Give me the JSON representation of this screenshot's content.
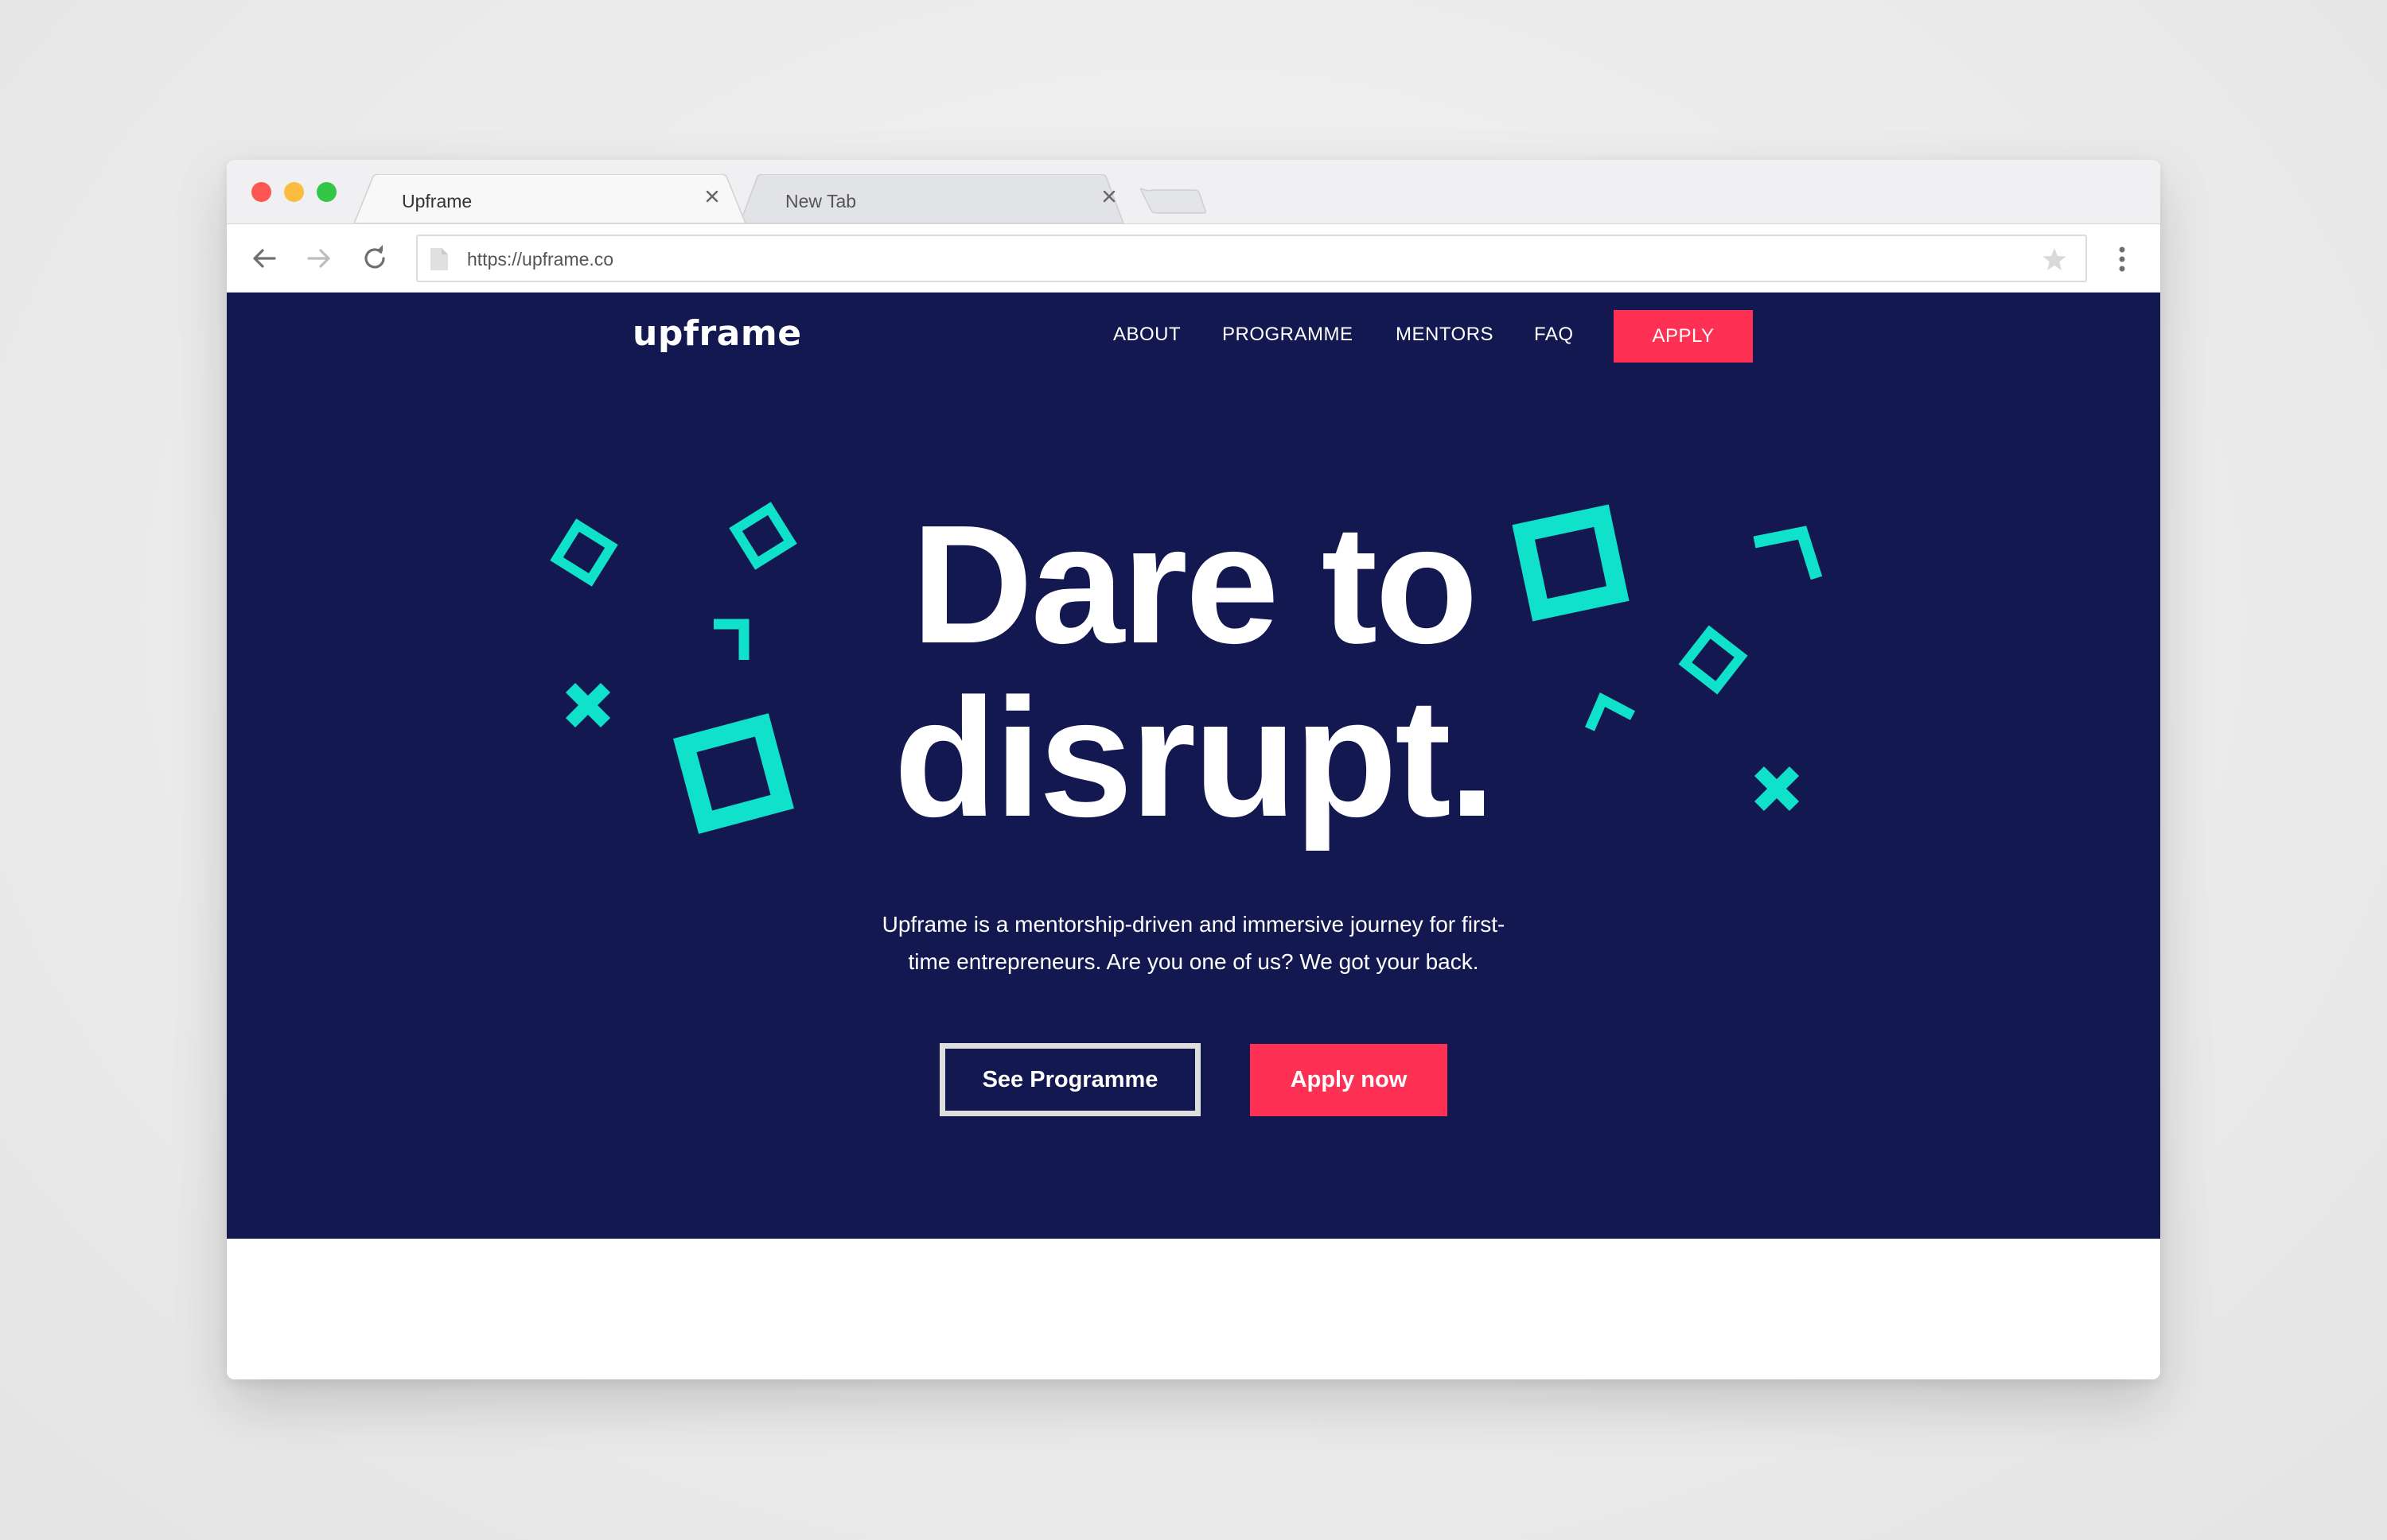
{
  "browser": {
    "tabs": [
      {
        "label": "Upframe",
        "active": true
      },
      {
        "label": "New Tab",
        "active": false
      }
    ],
    "url": "https://upframe.co"
  },
  "site": {
    "logo": "upframe",
    "nav": {
      "about": "ABOUT",
      "programme": "PROGRAMME",
      "mentors": "MENTORS",
      "faq": "FAQ",
      "apply": "APPLY"
    },
    "hero": {
      "headline_line1": "Dare to",
      "headline_line2": "disrupt.",
      "subtext_line1": "Upframe is a mentorship-driven and immersive journey for first-",
      "subtext_line2": "time entrepreneurs. Are you one of us? We got your back.",
      "primary_button": "Apply now",
      "secondary_button": "See Programme"
    }
  },
  "colors": {
    "hero_background": "#131850",
    "accent": "#fe3154",
    "decoration": "#10e1cb",
    "window_background": "#ececec"
  },
  "icons": {
    "back": "arrow-left-icon",
    "forward": "arrow-right-icon",
    "reload": "reload-icon",
    "page": "document-icon",
    "bookmark": "star-icon",
    "menu": "kebab-menu-icon",
    "close_tab": "close-icon"
  }
}
